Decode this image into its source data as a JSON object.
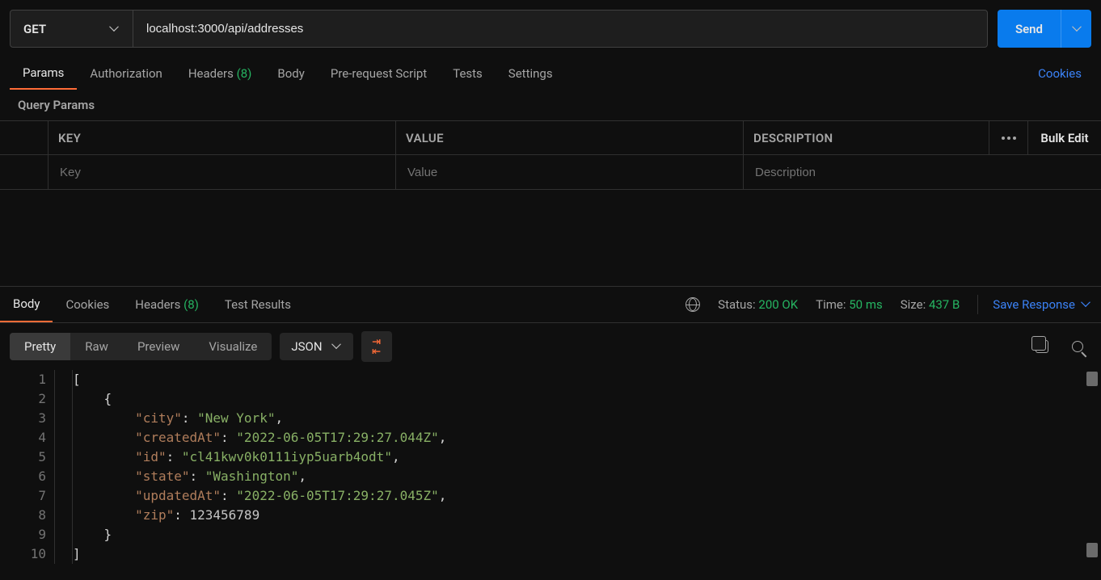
{
  "request": {
    "method": "GET",
    "url": "localhost:3000/api/addresses",
    "send_label": "Send"
  },
  "reqTabs": {
    "params": "Params",
    "authorization": "Authorization",
    "headers": "Headers",
    "headers_count": "(8)",
    "body": "Body",
    "prerequest": "Pre-request Script",
    "tests": "Tests",
    "settings": "Settings",
    "cookies": "Cookies"
  },
  "queryParams": {
    "section_label": "Query Params",
    "col_key": "KEY",
    "col_value": "VALUE",
    "col_desc": "DESCRIPTION",
    "bulk_edit": "Bulk Edit",
    "ph_key": "Key",
    "ph_value": "Value",
    "ph_desc": "Description"
  },
  "respTabs": {
    "body": "Body",
    "cookies": "Cookies",
    "headers": "Headers",
    "headers_count": "(8)",
    "test_results": "Test Results",
    "status_label": "Status:",
    "status_value": "200 OK",
    "time_label": "Time:",
    "time_value": "50 ms",
    "size_label": "Size:",
    "size_value": "437 B",
    "save_response": "Save Response"
  },
  "respViews": {
    "pretty": "Pretty",
    "raw": "Raw",
    "preview": "Preview",
    "visualize": "Visualize",
    "format": "JSON"
  },
  "responseBody": {
    "lines": [
      "1",
      "2",
      "3",
      "4",
      "5",
      "6",
      "7",
      "8",
      "9",
      "10"
    ],
    "obj": {
      "city_key": "\"city\"",
      "city_val": "\"New York\"",
      "createdAt_key": "\"createdAt\"",
      "createdAt_val": "\"2022-06-05T17:29:27.044Z\"",
      "id_key": "\"id\"",
      "id_val": "\"cl41kwv0k0111iyp5uarb4odt\"",
      "state_key": "\"state\"",
      "state_val": "\"Washington\"",
      "updatedAt_key": "\"updatedAt\"",
      "updatedAt_val": "\"2022-06-05T17:29:27.045Z\"",
      "zip_key": "\"zip\"",
      "zip_val": "123456789"
    }
  }
}
